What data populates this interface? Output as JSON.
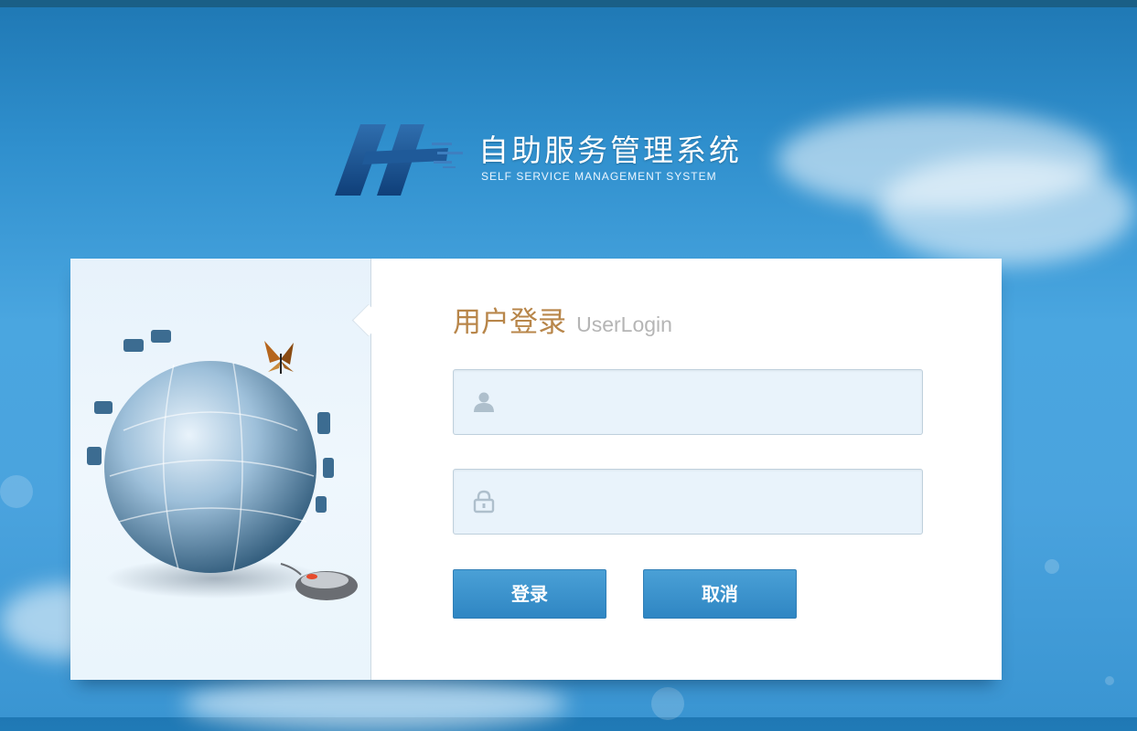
{
  "header": {
    "title": "自助服务管理系统",
    "subtitle": "SELF SERVICE MANAGEMENT SYSTEM",
    "logo_icon": "hm-logo-icon"
  },
  "login": {
    "title_cn": "用户登录",
    "title_en": "UserLogin",
    "username": {
      "value": "",
      "placeholder": "",
      "icon": "user-icon"
    },
    "password": {
      "value": "",
      "placeholder": "",
      "icon": "lock-icon"
    },
    "login_label": "登录",
    "cancel_label": "取消"
  },
  "illustration": {
    "name": "puzzle-globe-illustration"
  },
  "colors": {
    "accent_title": "#b8864a",
    "button_blue": "#3a92cc",
    "background_sky": "#3a95d2"
  }
}
